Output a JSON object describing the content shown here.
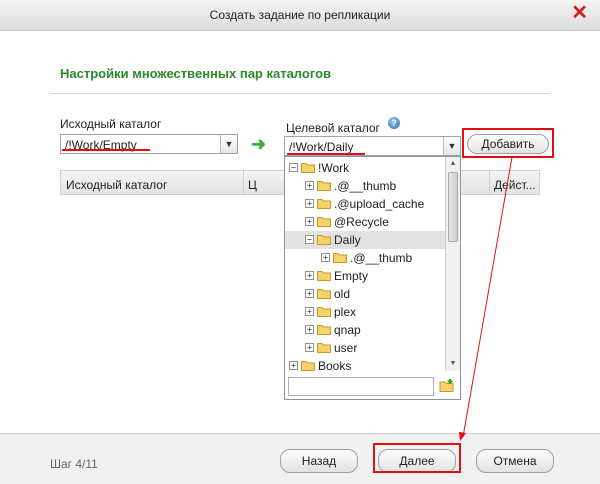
{
  "window": {
    "title": "Создать задание по репликации",
    "close_glyph": "✕"
  },
  "section": {
    "title": "Настройки множественных пар каталогов"
  },
  "source": {
    "label": "Исходный каталог",
    "value": "/!Work/Empty"
  },
  "target": {
    "label": "Целевой каталог",
    "value": "/!Work/Daily",
    "help_glyph": "?"
  },
  "add_button": {
    "label": "Добавить"
  },
  "grid": {
    "columns": [
      "Исходный каталог",
      "Ц",
      "Дейст..."
    ]
  },
  "tree": {
    "items": [
      {
        "label": "!Work",
        "expander": "−",
        "selected": false
      },
      {
        "label": ".@__thumb",
        "expander": "+",
        "selected": false
      },
      {
        "label": ".@upload_cache",
        "expander": "+",
        "selected": false
      },
      {
        "label": "@Recycle",
        "expander": "+",
        "selected": false
      },
      {
        "label": "Daily",
        "expander": "−",
        "selected": true
      },
      {
        "label": ".@__thumb",
        "expander": "+",
        "selected": false
      },
      {
        "label": "Empty",
        "expander": "+",
        "selected": false
      },
      {
        "label": "old",
        "expander": "+",
        "selected": false
      },
      {
        "label": "plex",
        "expander": "+",
        "selected": false
      },
      {
        "label": "qnap",
        "expander": "+",
        "selected": false
      },
      {
        "label": "user",
        "expander": "+",
        "selected": false
      },
      {
        "label": "Books",
        "expander": "+",
        "selected": false
      }
    ],
    "new_folder_placeholder": ""
  },
  "footer": {
    "step": "Шаг 4/11",
    "back": "Назад",
    "next": "Далее",
    "cancel": "Отмена"
  },
  "colors": {
    "accent_green": "#2b8a2b",
    "annotation_red": "#e01010",
    "close_red": "#d41c1c"
  },
  "icons": [
    "close-icon",
    "arrow-right-icon",
    "help-icon",
    "folder-icon",
    "new-folder-icon",
    "chevron-down-icon"
  ]
}
